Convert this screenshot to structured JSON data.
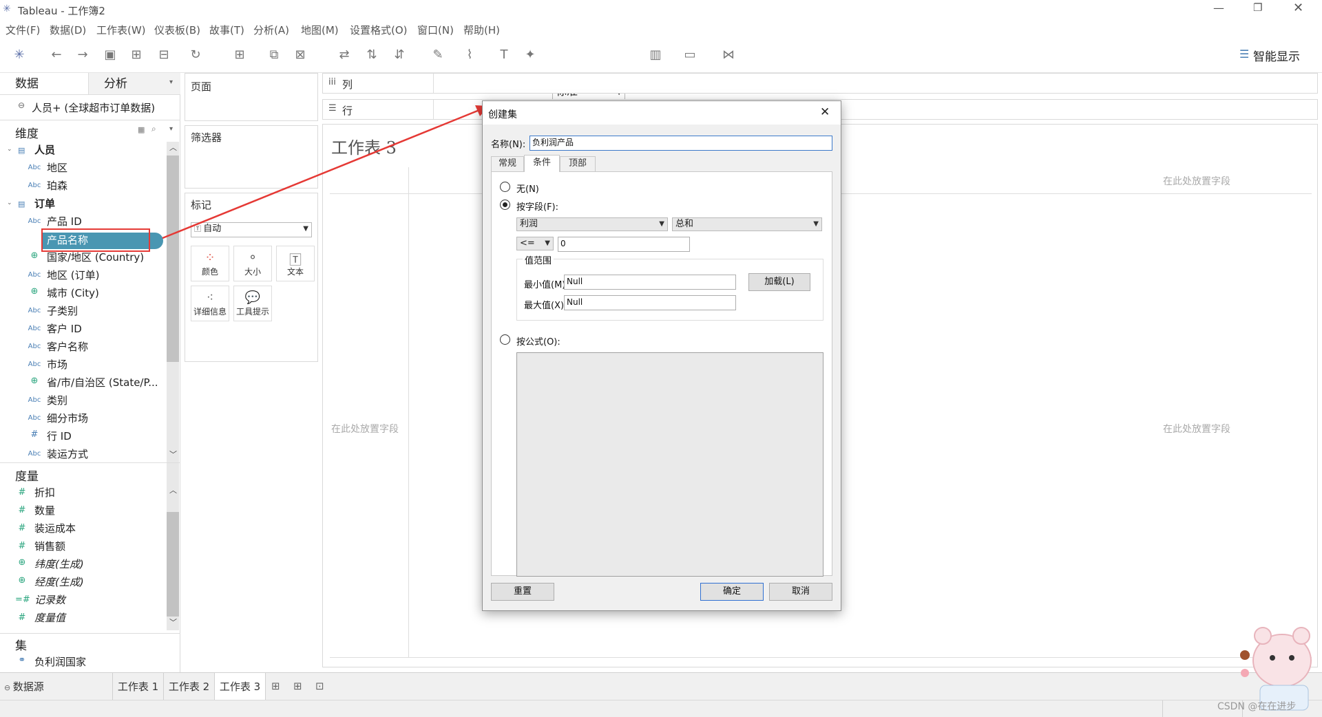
{
  "window": {
    "title": "Tableau - 工作簿2"
  },
  "menu": [
    "文件(F)",
    "数据(D)",
    "工作表(W)",
    "仪表板(B)",
    "故事(T)",
    "分析(A)",
    "地图(M)",
    "设置格式(O)",
    "窗口(N)",
    "帮助(H)"
  ],
  "toolbar": {
    "fit_value": "标准",
    "show_me": "智能显示"
  },
  "left": {
    "tab_data": "数据",
    "tab_analysis": "分析",
    "datasource": "人员+ (全球超市订单数据)",
    "dimensions_header": "维度",
    "group1": "人员",
    "group1_items": [
      "地区",
      "珀森"
    ],
    "group2": "订单",
    "group2_items": [
      "产品 ID",
      "产品名称",
      "国家/地区 (Country)",
      "地区 (订单)",
      "城市 (City)",
      "子类别",
      "客户 ID",
      "客户名称",
      "市场",
      "省/市/自治区 (State/P...",
      "类别",
      "细分市场",
      "行 ID",
      "装运方式"
    ],
    "group2_types": [
      "Abc",
      "Abc",
      "globe",
      "Abc",
      "globe",
      "Abc",
      "Abc",
      "Abc",
      "Abc",
      "globe",
      "Abc",
      "Abc",
      "#",
      "Abc"
    ],
    "measures_header": "度量",
    "measures": [
      "折扣",
      "数量",
      "装运成本",
      "销售额",
      "纬度(生成)",
      "经度(生成)",
      "记录数",
      "度量值"
    ],
    "sets_header": "集",
    "sets": [
      "负利润国家"
    ]
  },
  "cards": {
    "pages": "页面",
    "filters": "筛选器",
    "marks": "标记",
    "mark_type": "自动",
    "mark_buttons": [
      "颜色",
      "大小",
      "文本",
      "详细信息",
      "工具提示"
    ]
  },
  "shelves": {
    "columns": "列",
    "rows": "行"
  },
  "view": {
    "title": "工作表 3",
    "drop_field_1": "在此处放置字段",
    "drop_field_2": "在此处放置字段",
    "drop_field_3": "在此处放置字段"
  },
  "dialog": {
    "title": "创建集",
    "name_label": "名称(N):",
    "name_value": "负利润产品",
    "tabs": [
      "常规",
      "条件",
      "顶部"
    ],
    "none_label": "无(N)",
    "by_field_label": "按字段(F):",
    "field_value": "利润",
    "agg_value": "总和",
    "op_value": "<=",
    "cond_value": "0",
    "range_label": "值范围",
    "min_label": "最小值(M):",
    "min_value": "Null",
    "max_label": "最大值(X):",
    "max_value": "Null",
    "load_label": "加载(L)",
    "by_formula_label": "按公式(O):",
    "reset": "重置",
    "ok": "确定",
    "cancel": "取消"
  },
  "bottom": {
    "datasource": "数据源",
    "sheets": [
      "工作表 1",
      "工作表 2",
      "工作表 3"
    ]
  },
  "watermark": "CSDN @在在进步",
  "colors": {
    "highlight": "#e53935",
    "pill": "#4996b2",
    "accent": "#4a7fb5"
  }
}
